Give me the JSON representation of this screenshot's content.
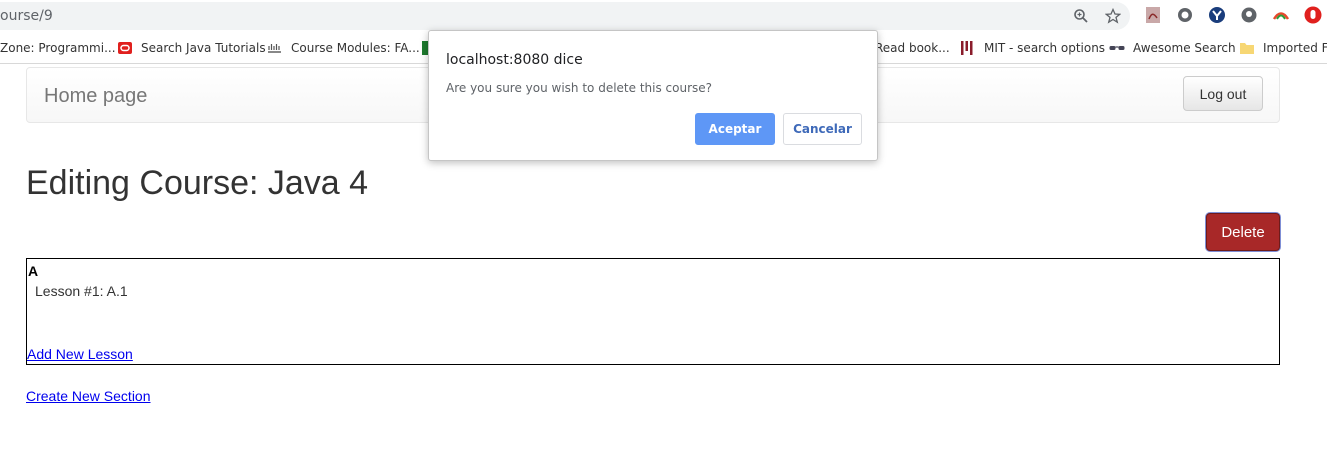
{
  "browser": {
    "url": "ourse/9",
    "bookmarks": [
      {
        "label": "Zone: Programmi...",
        "icon": "dzone-icon"
      },
      {
        "label": "Search Java Tutorials",
        "icon": "oracle-icon"
      },
      {
        "label": "Course Modules: FA...",
        "icon": "cisco-icon"
      },
      {
        "label": "Read book...",
        "icon": "book-icon"
      },
      {
        "label": "MIT - search options",
        "icon": "mit-icon"
      },
      {
        "label": "Awesome Search",
        "icon": "glasses-icon"
      },
      {
        "label": "Imported Fr",
        "icon": "folder-icon"
      }
    ]
  },
  "navbar": {
    "brand": "Home page",
    "logout_label": "Log out"
  },
  "main": {
    "title": "Editing Course: Java 4",
    "delete_label": "Delete",
    "section": {
      "title": "A",
      "lesson": "Lesson #1: A.1",
      "add_lesson": "Add New Lesson"
    },
    "create_section": "Create New Section"
  },
  "dialog": {
    "origin": "localhost:8080 dice",
    "message": "Are you sure you wish to delete this course?",
    "ok_label": "Aceptar",
    "cancel_label": "Cancelar"
  },
  "colors": {
    "delete": "#a82828",
    "dialog_ok": "#5e97f6",
    "link": "#0000ee"
  }
}
